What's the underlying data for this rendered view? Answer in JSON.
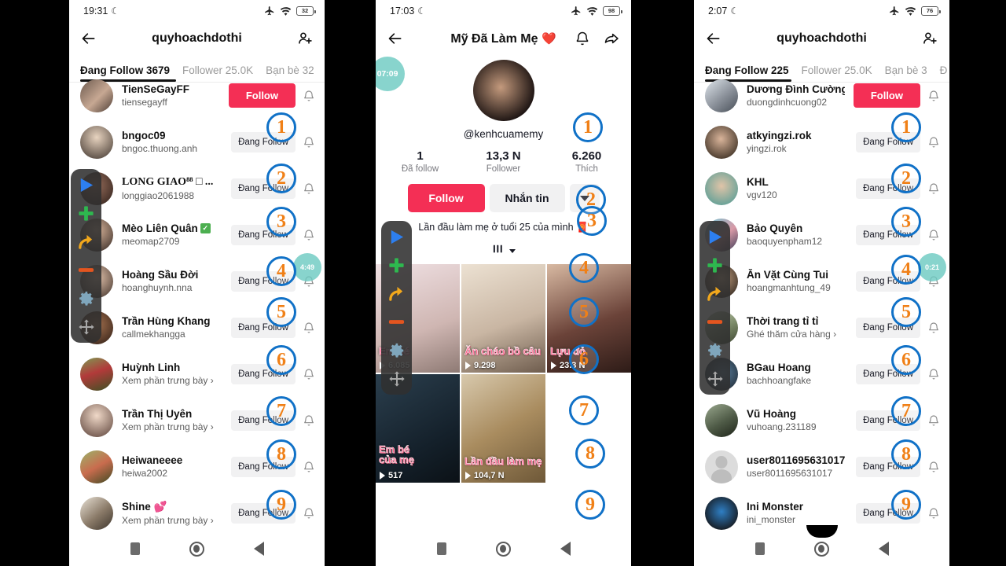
{
  "phones": [
    {
      "id": "phone-left",
      "status": {
        "time": "19:31",
        "battery": "32",
        "airplane_icon": "airplane-icon",
        "wifi_icon": "wifi-icon",
        "moon_icon": "moon-icon"
      },
      "header": {
        "back_icon": "back-arrow-icon",
        "title": "quyhoachdothi",
        "add_user_icon": "add-user-icon"
      },
      "tabs": [
        {
          "label": "Đang Follow 3679",
          "active": true
        },
        {
          "label": "Follower 25.0K",
          "active": false
        },
        {
          "label": "Bạn bè 32",
          "active": false
        }
      ],
      "users": [
        {
          "name": "TienSeGayFF",
          "sub": "tiensegayff",
          "action": "Follow",
          "action_type": "follow",
          "serif": false,
          "badge_after": null
        },
        {
          "name": "bngoc09",
          "sub": "bngoc.thuong.anh",
          "action": "Đang Follow",
          "action_type": "following",
          "serif": false
        },
        {
          "name": "LONG GIAO⁸⁸ □ ...",
          "sub": "longgiao2061988",
          "action": "Đang Follow",
          "action_type": "following",
          "serif": true
        },
        {
          "name": "Mèo Liên Quân",
          "sub": "meomap2709",
          "action": "Đang Follow",
          "action_type": "following",
          "serif": false,
          "verified": true
        },
        {
          "name": "Hoàng Sầu Đời",
          "sub": "hoanghuynh.nna",
          "action": "Đang Follow",
          "action_type": "following",
          "serif": false
        },
        {
          "name": "Trần Hùng Khang",
          "sub": "callmekhangga",
          "action": "Đang Follow",
          "action_type": "following",
          "serif": false
        },
        {
          "name": "Huỳnh Linh",
          "sub": "Xem phần trưng bày ›",
          "action": "Đang Follow",
          "action_type": "following",
          "serif": false
        },
        {
          "name": "Trần Thị Uyên",
          "sub": "Xem phần trưng bày ›",
          "action": "Đang Follow",
          "action_type": "following",
          "serif": false
        },
        {
          "name": "Heiwaneeee",
          "sub": "heiwa2002",
          "action": "Đang Follow",
          "action_type": "following",
          "serif": false
        },
        {
          "name": "Shine 💕",
          "sub": "Xem phần trưng bày ›",
          "action": "Đang Follow",
          "action_type": "following",
          "serif": false
        }
      ],
      "step_badges": [
        "1",
        "2",
        "3",
        "4",
        "5",
        "6",
        "7",
        "8",
        "9"
      ],
      "timer_badge": "4:49",
      "corner_timer": null
    },
    {
      "id": "phone-middle",
      "status": {
        "time": "17:03",
        "battery": "98",
        "airplane_icon": "airplane-icon",
        "wifi_icon": "wifi-icon",
        "moon_icon": "moon-icon"
      },
      "header": {
        "back_icon": "back-arrow-icon",
        "title": "Mỹ Đã Làm Mẹ",
        "title_emoji": "❤️",
        "bell_icon": "bell-icon",
        "share_icon": "share-icon"
      },
      "profile": {
        "handle": "@kenhcuamemy",
        "stats": [
          {
            "num": "1",
            "label": "Đã follow"
          },
          {
            "num": "13,3 N",
            "label": "Follower"
          },
          {
            "num": "6.260",
            "label": "Thích"
          }
        ],
        "follow_label": "Follow",
        "message_label": "Nhắn tin",
        "more_icon": "chevron-down-icon",
        "bio": "Lần đầu làm mẹ ở tuổi 25 của mình 🧧",
        "grid_tab_icon": "grid-icon",
        "grid_tab_caret": "caret-down-icon"
      },
      "videos": [
        {
          "caption": "Em bé",
          "plays": "6.085",
          "bg": "#e8d9dd"
        },
        {
          "caption": "Ăn cháo bồ câu",
          "plays": "9.298",
          "bg": "#d9cfc6"
        },
        {
          "caption": "Lựu đỏ",
          "plays": "23.3 N",
          "bg": "#6d4a42"
        },
        {
          "caption": "Em bé\ncủa mẹ",
          "plays": "517",
          "bg": "#1d2b35"
        },
        {
          "caption": "Lần đầu làm mẹ",
          "plays": "104,7 N",
          "bg": "#b9a58f"
        }
      ],
      "step_badges": [
        "1",
        "2",
        "3",
        "4",
        "5",
        "6",
        "7",
        "8",
        "9"
      ],
      "corner_timer": "07:09"
    },
    {
      "id": "phone-right",
      "status": {
        "time": "2:07",
        "battery": "76",
        "airplane_icon": "airplane-icon",
        "wifi_icon": "wifi-icon",
        "moon_icon": "moon-icon"
      },
      "header": {
        "back_icon": "back-arrow-icon",
        "title": "quyhoachdothi",
        "add_user_icon": "add-user-icon"
      },
      "tabs": [
        {
          "label": "Đang Follow 225",
          "active": true
        },
        {
          "label": "Follower 25.0K",
          "active": false
        },
        {
          "label": "Bạn bè 3",
          "active": false
        },
        {
          "label": "Đ",
          "active": false
        }
      ],
      "users": [
        {
          "name": "Dương Đình Cường",
          "sub": "duongdinhcuong02",
          "action": "Follow",
          "action_type": "follow",
          "serif": false,
          "flag": true
        },
        {
          "name": "atkyingzi.rok",
          "sub": "yingzi.rok",
          "action": "Đang Follow",
          "action_type": "following",
          "serif": false
        },
        {
          "name": "KHL",
          "sub": "vgv120",
          "action": "Đang Follow",
          "action_type": "following",
          "serif": false
        },
        {
          "name": "Bảo Quyên",
          "sub": "baoquyenpham12",
          "action": "Đang Follow",
          "action_type": "following",
          "serif": false
        },
        {
          "name": "Ăn Vặt Cùng Tui",
          "sub": "hoangmanhtung_49",
          "action": "Đang Follow",
          "action_type": "following",
          "serif": false
        },
        {
          "name": "Thời trang tỉ tỉ",
          "sub": "Ghé thăm cửa hàng ›",
          "action": "Đang Follow",
          "action_type": "following",
          "serif": false
        },
        {
          "name": "BGau Hoang",
          "sub": "bachhoangfake",
          "action": "Đang Follow",
          "action_type": "following",
          "serif": false
        },
        {
          "name": "Vũ Hoàng",
          "sub": "vuhoang.231189",
          "action": "Đang Follow",
          "action_type": "following",
          "serif": false
        },
        {
          "name": "user8011695631017",
          "sub": "user8011695631017",
          "action": "Đang Follow",
          "action_type": "following",
          "serif": false,
          "blank_avatar": true
        },
        {
          "name": "Ini Monster",
          "sub": "ini_monster",
          "action": "Đang Follow",
          "action_type": "following",
          "serif": false
        }
      ],
      "step_badges": [
        "1",
        "2",
        "3",
        "4",
        "5",
        "6",
        "7",
        "8",
        "9"
      ],
      "timer_badge": "0:21",
      "corner_timer": null
    }
  ],
  "floating_toolbar": {
    "buttons": [
      {
        "name": "play-icon",
        "color": "#2d7ff0"
      },
      {
        "name": "plus-icon",
        "color": "#2eb84f"
      },
      {
        "name": "redo-arrow-icon",
        "color": "#f2a81c"
      },
      {
        "name": "minus-icon",
        "color": "#e4551f"
      },
      {
        "name": "gear-icon",
        "color": "#7fa6bc"
      },
      {
        "name": "move-icon",
        "color": "#9a9a9a"
      }
    ]
  },
  "navbar": {
    "recents_icon": "recents-square-icon",
    "home_icon": "home-circle-icon",
    "back_icon": "back-triangle-icon"
  },
  "colors": {
    "accent_red": "#f42f55",
    "badge_ring": "#1071c7",
    "badge_number": "#f08017",
    "timer_badge": "#6ac9c0"
  }
}
